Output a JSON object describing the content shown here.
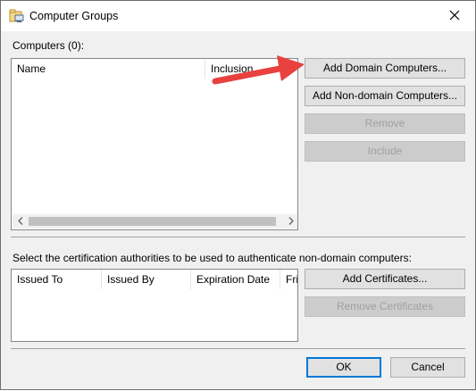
{
  "window": {
    "title": "Computer Groups",
    "icon": "computer-groups-icon"
  },
  "computers": {
    "label": "Computers (0):",
    "columns": [
      "Name",
      "Inclusion"
    ]
  },
  "buttons": {
    "add_domain": "Add Domain Computers...",
    "add_nondomain": "Add Non-domain Computers...",
    "remove": "Remove",
    "include": "Include",
    "add_certs": "Add Certificates...",
    "remove_certs": "Remove Certificates",
    "ok": "OK",
    "cancel": "Cancel"
  },
  "certs": {
    "label": "Select the certification authorities to be used to authenticate non-domain computers:",
    "columns": [
      "Issued To",
      "Issued By",
      "Expiration Date",
      "Fri"
    ]
  },
  "annotation": {
    "arrow_color": "#e8413f"
  }
}
